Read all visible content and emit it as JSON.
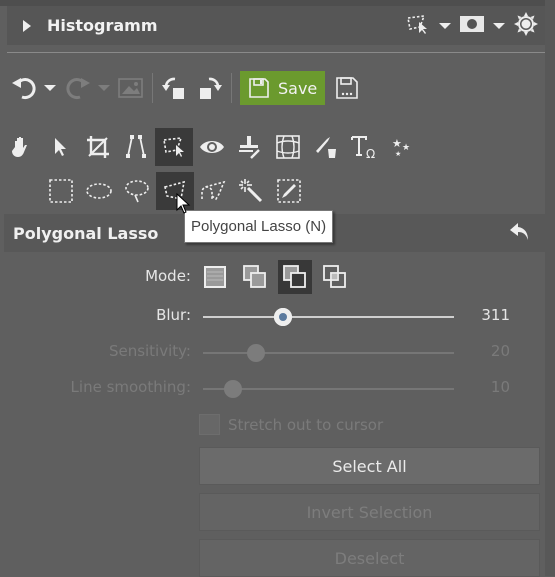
{
  "histogram_panel": {
    "title": "Histogramm",
    "expanded": false
  },
  "toolbar": {
    "save_label": "Save"
  },
  "tools_row1": [
    {
      "name": "hand-tool"
    },
    {
      "name": "select-pointer-tool"
    },
    {
      "name": "crop-tool"
    },
    {
      "name": "perspective-tool"
    },
    {
      "name": "selection-tool",
      "active": true
    },
    {
      "name": "red-eye-tool"
    },
    {
      "name": "clone-stamp-tool"
    },
    {
      "name": "warp-tool"
    },
    {
      "name": "paint-bucket-brush-tool"
    },
    {
      "name": "text-tool"
    },
    {
      "name": "effects-tool"
    }
  ],
  "tools_row2": [
    {
      "name": "rectangle-selection-tool"
    },
    {
      "name": "ellipse-selection-tool"
    },
    {
      "name": "lasso-tool"
    },
    {
      "name": "polygonal-lasso-tool",
      "active": true
    },
    {
      "name": "magnetic-lasso-tool"
    },
    {
      "name": "magic-wand-tool"
    },
    {
      "name": "selection-brush-tool"
    }
  ],
  "tooltip": "Polygonal Lasso (N)",
  "section": {
    "title": "Polygonal Lasso"
  },
  "options": {
    "mode_label": "Mode:",
    "mode_selected_index": 2,
    "blur": {
      "label": "Blur:",
      "value": "311",
      "position_fraction": 0.32,
      "enabled": true
    },
    "sensitivity": {
      "label": "Sensitivity:",
      "value": "20",
      "position_fraction": 0.21,
      "enabled": false
    },
    "line_smoothing": {
      "label": "Line smoothing:",
      "value": "10",
      "position_fraction": 0.12,
      "enabled": false
    },
    "stretch_label": "Stretch out to cursor",
    "stretch_checked": false
  },
  "buttons": {
    "select_all": "Select All",
    "invert_selection": "Invert Selection",
    "deselect": "Deselect"
  },
  "colors": {
    "save_green": "#6b9a2e",
    "blur_thumb": "#5b7a9e"
  }
}
